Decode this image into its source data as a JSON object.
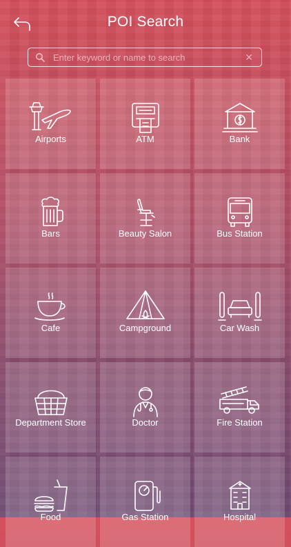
{
  "header": {
    "title": "POI Search"
  },
  "search": {
    "placeholder": "Enter keyword or name to search",
    "value": ""
  },
  "categories": [
    {
      "label": "Airports",
      "icon": "airport-icon"
    },
    {
      "label": "ATM",
      "icon": "atm-icon"
    },
    {
      "label": "Bank",
      "icon": "bank-icon"
    },
    {
      "label": "Bars",
      "icon": "beer-mug-icon"
    },
    {
      "label": "Beauty Salon",
      "icon": "salon-chair-icon"
    },
    {
      "label": "Bus Station",
      "icon": "bus-icon"
    },
    {
      "label": "Cafe",
      "icon": "coffee-cup-icon"
    },
    {
      "label": "Campground",
      "icon": "tent-icon"
    },
    {
      "label": "Car Wash",
      "icon": "car-wash-icon"
    },
    {
      "label": "Department Store",
      "icon": "shopping-basket-icon"
    },
    {
      "label": "Doctor",
      "icon": "doctor-icon"
    },
    {
      "label": "Fire Station",
      "icon": "fire-truck-icon"
    },
    {
      "label": "Food",
      "icon": "fast-food-icon"
    },
    {
      "label": "Gas Station",
      "icon": "gas-pump-icon"
    },
    {
      "label": "Hospital",
      "icon": "hospital-icon"
    }
  ]
}
